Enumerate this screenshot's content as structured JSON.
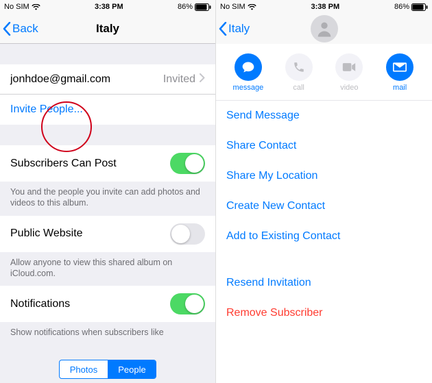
{
  "status": {
    "carrier": "No SIM",
    "wifi_icon": "wifi-icon",
    "time": "3:38 PM",
    "battery_pct": "86%",
    "battery_icon": "battery-icon"
  },
  "left": {
    "nav": {
      "back_label": "Back",
      "title": "Italy"
    },
    "subscriber": {
      "email": "jonhdoe@gmail.com",
      "status": "Invited"
    },
    "invite_label": "Invite People...",
    "setting1": {
      "label": "Subscribers Can Post",
      "value": true,
      "footer": "You and the people you invite can add photos and videos to this album."
    },
    "setting2": {
      "label": "Public Website",
      "value": false,
      "footer": "Allow anyone to view this shared album on iCloud.com."
    },
    "setting3": {
      "label": "Notifications",
      "value": true,
      "footer": "Show notifications when subscribers like"
    },
    "segmented": {
      "a": "Photos",
      "b": "People"
    }
  },
  "right": {
    "nav": {
      "back_label": "Italy"
    },
    "actions": {
      "message": "message",
      "call": "call",
      "video": "video",
      "mail": "mail"
    },
    "options": {
      "send_message": "Send Message",
      "share_contact": "Share Contact",
      "share_location": "Share My Location",
      "create_contact": "Create New Contact",
      "add_existing": "Add to Existing Contact",
      "resend": "Resend Invitation",
      "remove": "Remove Subscriber"
    }
  }
}
